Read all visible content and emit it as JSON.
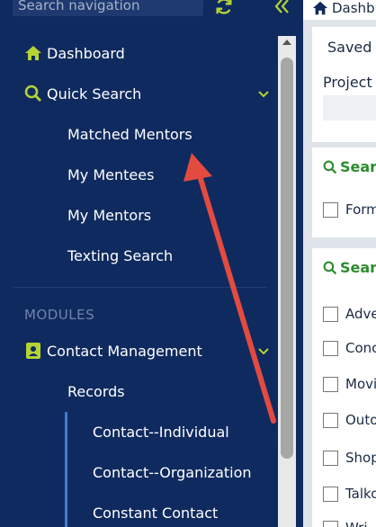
{
  "sidebar": {
    "search_placeholder": "Search navigation",
    "items": [
      {
        "label": "Dashboard"
      },
      {
        "label": "Quick Search"
      },
      {
        "label": "Matched Mentors"
      },
      {
        "label": "My Mentees"
      },
      {
        "label": "My Mentors"
      },
      {
        "label": "Texting Search"
      }
    ],
    "section_label": "MODULES",
    "modules": [
      {
        "label": "Contact Management"
      },
      {
        "label": "Records"
      },
      {
        "label": "Contact--Individual"
      },
      {
        "label": "Contact--Organization"
      },
      {
        "label": "Constant Contact"
      }
    ]
  },
  "content": {
    "breadcrumb": "Dashb",
    "saved": "Saved",
    "project_label": "Project",
    "search_head_1": "Sear",
    "search_head_2": "Sear",
    "checkbox_1": "Form",
    "checkboxes": [
      "Adve",
      "Conc",
      "Movi",
      "Outo",
      "Shop",
      "Talko",
      "Wri"
    ]
  },
  "colors": {
    "sidebar_bg": "#0f2a5f",
    "accent_green": "#b5d334",
    "search_green": "#2e8b2e",
    "arrow_red": "#e34b40"
  },
  "icons": [
    "home-icon",
    "search-icon",
    "contact-card-icon",
    "refresh-icon",
    "collapse-icon",
    "chevron-down-icon",
    "checkbox-icon"
  ]
}
